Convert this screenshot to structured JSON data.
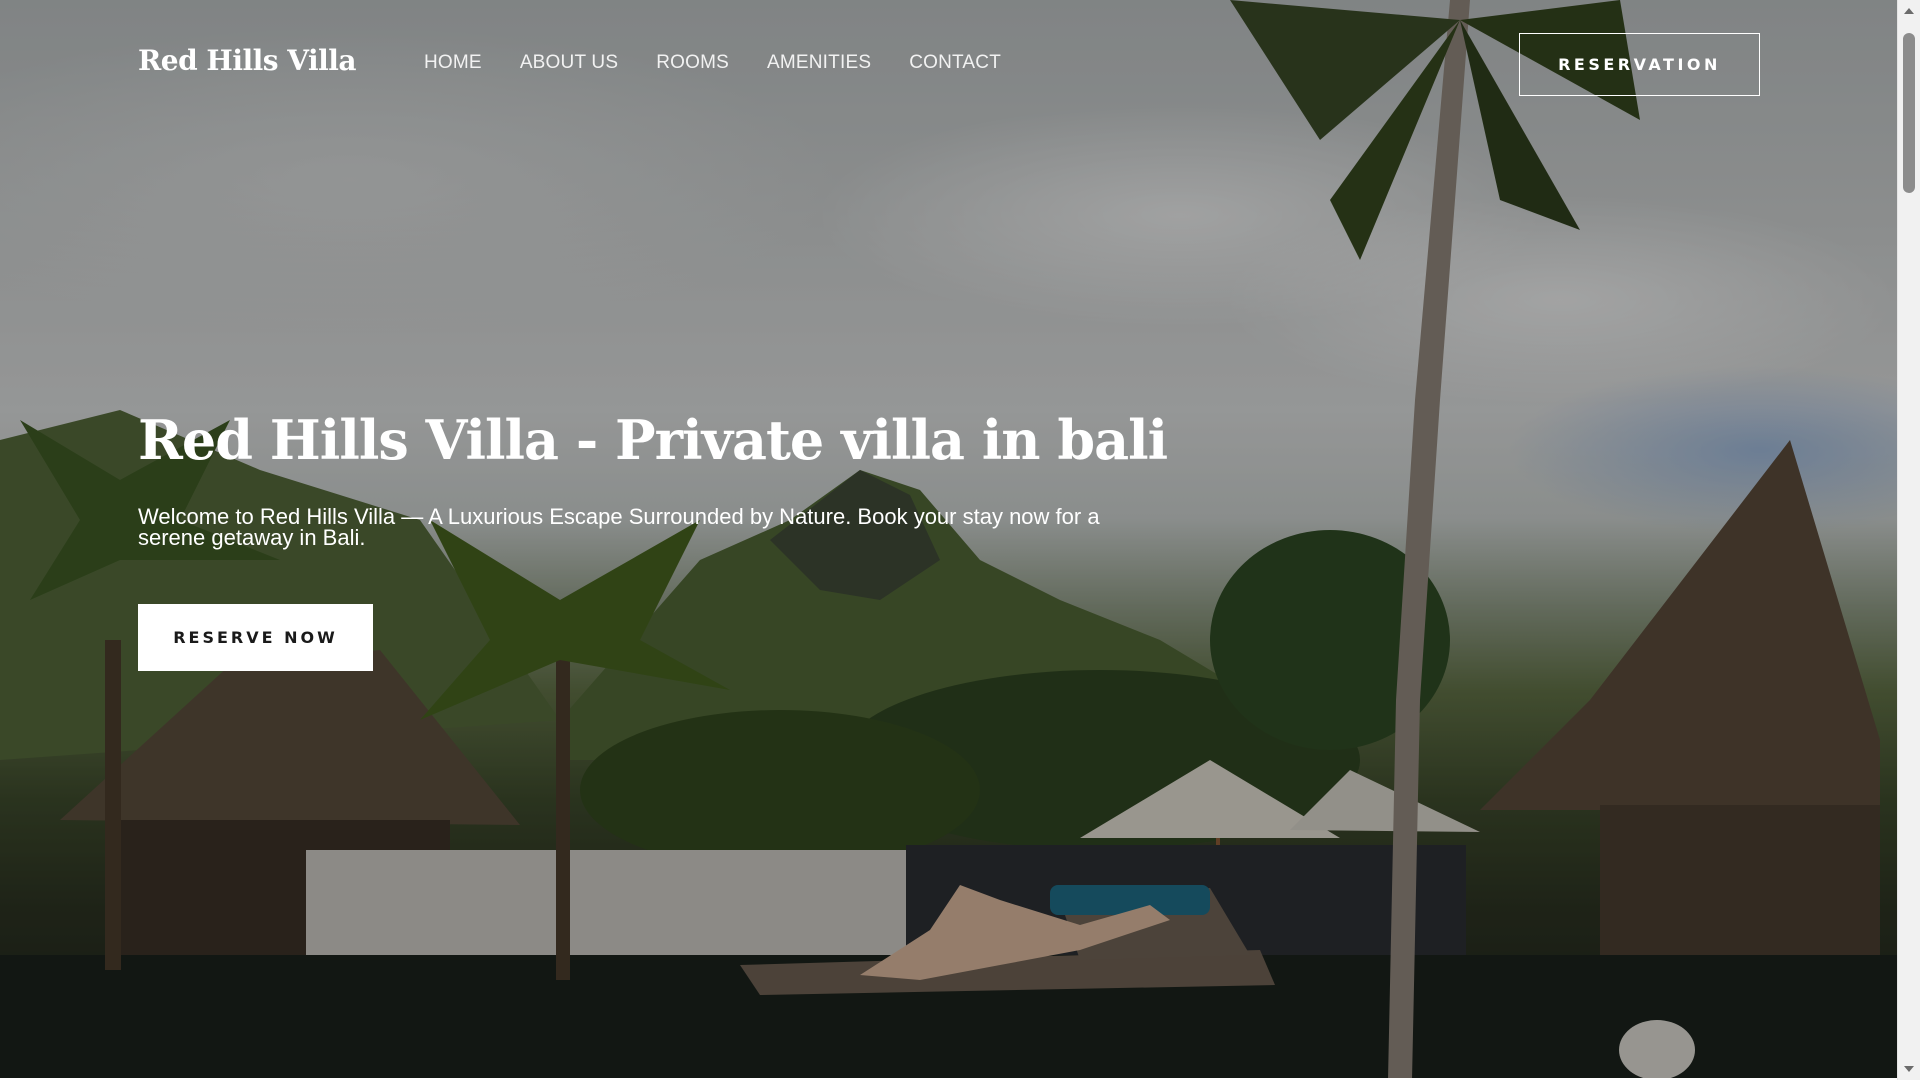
{
  "site": {
    "logo": "Red Hills Villa"
  },
  "nav": {
    "links": [
      "HOME",
      "ABOUT US",
      "ROOMS",
      "AMENITIES",
      "CONTACT"
    ],
    "reservation_label": "RESERVATION"
  },
  "hero": {
    "title": "Red Hills Villa - Private villa in bali",
    "subtitle": "Welcome to Red Hills Villa — A Luxurious Escape Surrounded by Nature. Book your stay now for a serene getaway in Bali.",
    "cta_label": "RESERVE NOW"
  },
  "colors": {
    "text": "#ffffff",
    "button_bg": "#ffffff",
    "button_text": "#1a1a1a"
  },
  "icons": {
    "scroll_up": "triangle-up-icon",
    "scroll_down": "triangle-down-icon"
  }
}
